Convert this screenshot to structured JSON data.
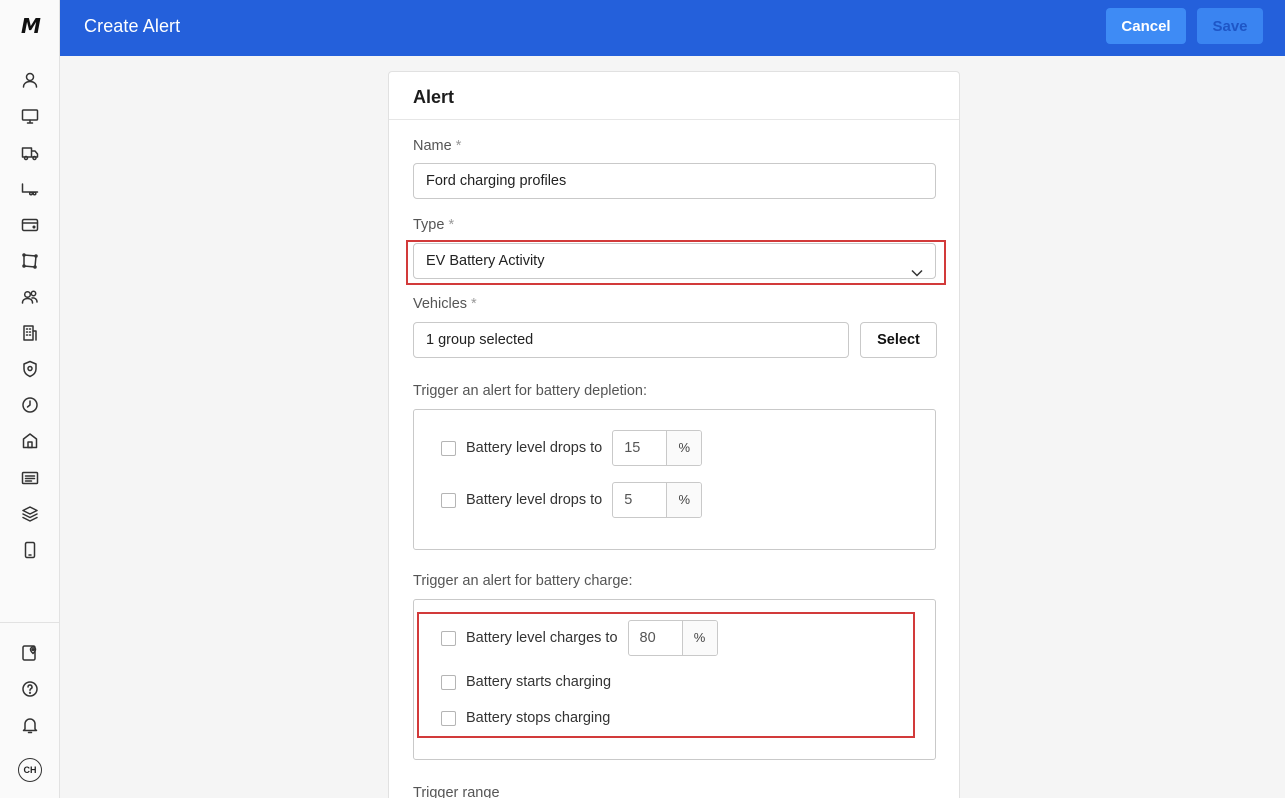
{
  "app": {
    "logo_text": "M",
    "avatar_initials": "CH"
  },
  "sidebar": {
    "icons": [
      "user-icon",
      "monitor-icon",
      "truck-icon",
      "trailer-icon",
      "card-icon",
      "route-icon",
      "users-icon",
      "building-icon",
      "shield-icon",
      "clock-icon",
      "house-icon",
      "news-icon",
      "layers-icon",
      "phone-icon"
    ],
    "bottom_icons": [
      "map-pin-icon",
      "help-icon",
      "bell-icon"
    ]
  },
  "header": {
    "title": "Create Alert",
    "cancel_label": "Cancel",
    "save_label": "Save"
  },
  "card": {
    "title": "Alert",
    "name": {
      "label": "Name",
      "required": "*",
      "value": "Ford charging profiles"
    },
    "type": {
      "label": "Type",
      "required": "*",
      "value": "EV Battery Activity"
    },
    "vehicles": {
      "label": "Vehicles",
      "required": "*",
      "value": "1 group selected",
      "button": "Select"
    },
    "depletion": {
      "label": "Trigger an alert for battery depletion:",
      "rows": [
        {
          "label": "Battery level drops to",
          "value": "15",
          "unit": "%"
        },
        {
          "label": "Battery level drops to",
          "value": "5",
          "unit": "%"
        }
      ]
    },
    "charge": {
      "label": "Trigger an alert for battery charge:",
      "level_row": {
        "label": "Battery level charges to",
        "value": "80",
        "unit": "%"
      },
      "starts_label": "Battery starts charging",
      "stops_label": "Battery stops charging"
    },
    "trigger_range_label": "Trigger range"
  },
  "colors": {
    "header_bg": "#2460db",
    "button_bg": "#3e8bf5",
    "highlight": "#d23a3a"
  }
}
